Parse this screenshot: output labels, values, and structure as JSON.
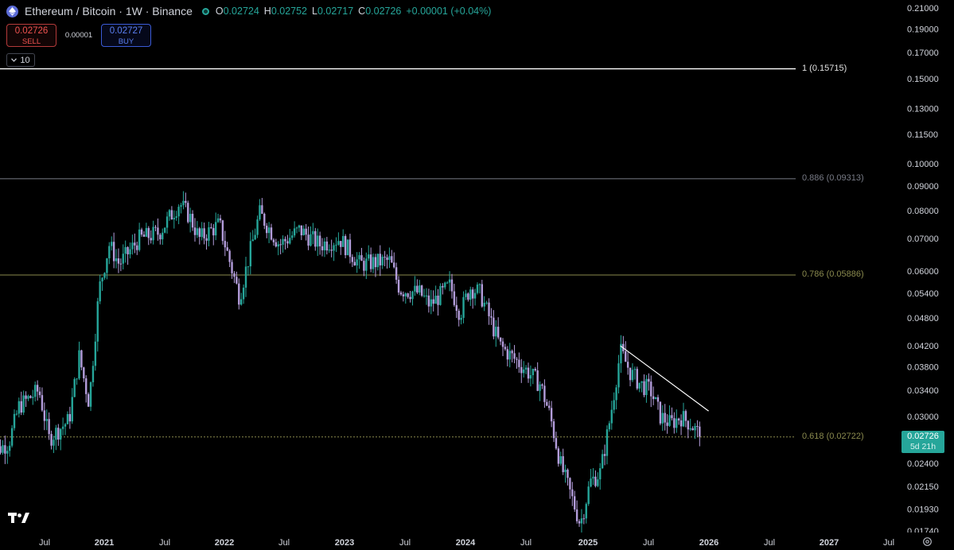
{
  "header": {
    "title": "Ethereum / Bitcoin · 1W · Binance",
    "ohlc": [
      {
        "k": "O",
        "v": "0.02724"
      },
      {
        "k": "H",
        "v": "0.02752"
      },
      {
        "k": "L",
        "v": "0.02717"
      },
      {
        "k": "C",
        "v": "0.02726"
      }
    ],
    "change": "+0.00001 (+0.04%)"
  },
  "trade": {
    "sell_price": "0.02726",
    "sell_label": "SELL",
    "spread": "0.00001",
    "buy_price": "0.02727",
    "buy_label": "BUY"
  },
  "indicators_toggle": "10",
  "price_axis_labels": [
    "0.21000",
    "0.19000",
    "0.17000",
    "0.15000",
    "0.13000",
    "0.11500",
    "0.10000",
    "0.09000",
    "0.08000",
    "0.07000",
    "0.06000",
    "0.05400",
    "0.04800",
    "0.04200",
    "0.03800",
    "0.03400",
    "0.03000",
    "0.02400",
    "0.02150",
    "0.01930",
    "0.01740"
  ],
  "time_axis_labels": [
    "Jul",
    "2021",
    "Jul",
    "2022",
    "Jul",
    "2023",
    "Jul",
    "2024",
    "Jul",
    "2025",
    "Jul",
    "2026",
    "Jul",
    "2027",
    "Jul"
  ],
  "fib_levels": [
    {
      "label": "1 (0.15715)",
      "color": "#ffffff"
    },
    {
      "label": "0.886 (0.09313)",
      "color": "#787b86"
    },
    {
      "label": "0.786 (0.05886)",
      "color": "#8a8a4e"
    },
    {
      "label": "0.618 (0.02722)",
      "color": "#8a8a4e"
    }
  ],
  "last_price": {
    "value": "0.02726",
    "countdown": "5d 21h"
  },
  "colors": {
    "up": "#26a69a",
    "down": "#b39ddb",
    "background": "#000000"
  },
  "icons": {
    "logo": "tradingview-logo-icon",
    "settings": "gear-icon",
    "symbol": "ethereum-icon"
  },
  "chart_data": {
    "type": "candlestick",
    "title": "Ethereum / Bitcoin · 1W · Binance",
    "scale": "log",
    "ylim": [
      0.0174,
      0.21
    ],
    "x_range": [
      "2020-05",
      "2027-08"
    ],
    "series": [
      {
        "values": [
          [
            "2020-05",
            0.025
          ],
          [
            "2020-07",
            0.0265
          ],
          [
            "2020-08",
            0.0315
          ],
          [
            "2020-10",
            0.034
          ],
          [
            "2020-11",
            0.027
          ],
          [
            "2021-01",
            0.0295
          ],
          [
            "2021-02",
            0.04
          ],
          [
            "2021-03",
            0.032
          ],
          [
            "2021-04",
            0.055
          ],
          [
            "2021-05",
            0.068
          ],
          [
            "2021-06",
            0.062
          ],
          [
            "2021-08",
            0.07
          ],
          [
            "2021-10",
            0.072
          ],
          [
            "2021-12",
            0.083
          ],
          [
            "2022-01",
            0.078
          ],
          [
            "2022-02",
            0.07
          ],
          [
            "2022-04",
            0.075
          ],
          [
            "2022-06",
            0.053
          ],
          [
            "2022-07",
            0.065
          ],
          [
            "2022-08",
            0.079
          ],
          [
            "2022-10",
            0.068
          ],
          [
            "2022-12",
            0.073
          ],
          [
            "2023-02",
            0.068
          ],
          [
            "2023-04",
            0.07
          ],
          [
            "2023-06",
            0.062
          ],
          [
            "2023-09",
            0.063
          ],
          [
            "2023-10",
            0.055
          ],
          [
            "2023-12",
            0.054
          ],
          [
            "2024-01",
            0.051
          ],
          [
            "2024-03",
            0.056
          ],
          [
            "2024-04",
            0.049
          ],
          [
            "2024-05",
            0.0555
          ],
          [
            "2024-06",
            0.054
          ],
          [
            "2024-08",
            0.042
          ],
          [
            "2024-10",
            0.0385
          ],
          [
            "2024-12",
            0.035
          ],
          [
            "2025-01",
            0.03
          ],
          [
            "2025-02",
            0.024
          ],
          [
            "2025-04",
            0.018
          ],
          [
            "2025-05",
            0.022
          ],
          [
            "2025-06",
            0.023
          ],
          [
            "2025-07",
            0.03
          ],
          [
            "2025-08",
            0.041
          ],
          [
            "2025-09",
            0.037
          ],
          [
            "2025-10",
            0.035
          ],
          [
            "2025-11",
            0.034
          ],
          [
            "2025-12",
            0.03
          ],
          [
            "2026-01",
            0.029
          ],
          [
            "2026-02",
            0.03
          ],
          [
            "2026-03",
            0.029
          ],
          [
            "2026-04",
            0.02726
          ]
        ]
      }
    ],
    "trendline": {
      "from": [
        "2025-08",
        0.042
      ],
      "to": [
        "2026-04",
        0.0308
      ]
    }
  }
}
